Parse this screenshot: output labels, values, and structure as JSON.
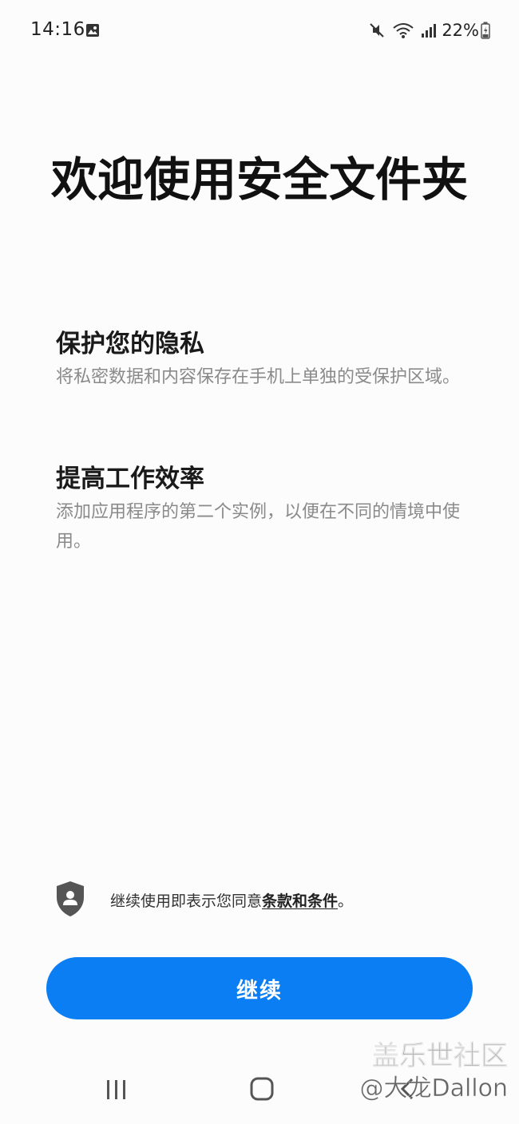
{
  "status_bar": {
    "time": "14:16",
    "battery": "22%",
    "icons": [
      "gallery-icon",
      "mute-icon",
      "wifi-icon",
      "signal-icon",
      "battery-icon"
    ]
  },
  "title": "欢迎使用安全文件夹",
  "features": [
    {
      "title": "保护您的隐私",
      "description": "将私密数据和内容保存在手机上单独的受保护区域。"
    },
    {
      "title": "提高工作效率",
      "description": "添加应用程序的第二个实例，以便在不同的情境中使用。"
    }
  ],
  "terms": {
    "prefix": "继续使用即表示您同意",
    "link": "条款和条件",
    "suffix": "。",
    "icon": "shield-user-icon"
  },
  "continue_button": {
    "label": "继续",
    "color": "#0b7ef4"
  },
  "nav_bar": {
    "icons": [
      "recent-apps-icon",
      "home-icon",
      "back-icon"
    ]
  },
  "watermark": {
    "line1": "盖乐世社区",
    "line2": "@大龙Dallon"
  }
}
